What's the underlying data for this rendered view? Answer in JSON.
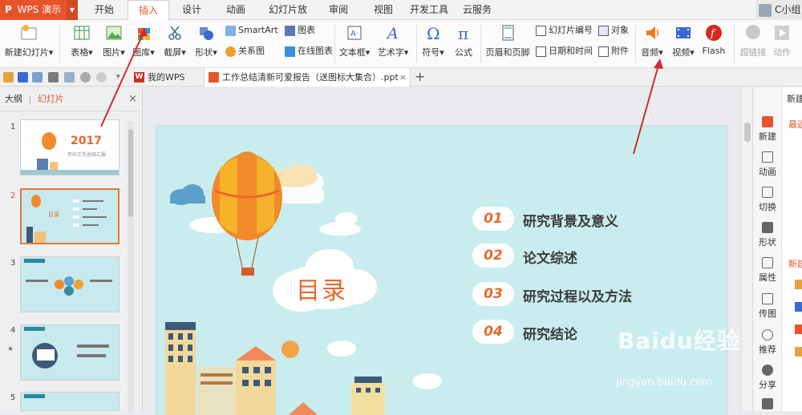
{
  "app": {
    "name": "WPS 演示",
    "user": "C小组"
  },
  "tabs": [
    "开始",
    "插入",
    "设计",
    "动画",
    "幻灯片放映",
    "审阅",
    "视图",
    "开发工具",
    "云服务"
  ],
  "active_tab": "插入",
  "ribbon": {
    "new_slide": "新建幻灯片",
    "table": "表格",
    "picture": "图片",
    "gallery": "图库",
    "screenshot": "截屏",
    "shape": "形状",
    "smartart": "SmartArt",
    "relation": "关系图",
    "chart": "图表",
    "online_chart": "在线图表",
    "textbox": "文本框",
    "wordart": "艺术字",
    "symbol": "符号",
    "formula": "公式",
    "header_footer": "页眉和页脚",
    "slide_number": "幻灯片编号",
    "datetime": "日期和时间",
    "object": "对象",
    "attachment": "附件",
    "audio": "音频",
    "video": "视频",
    "flash": "Flash",
    "hyperlink": "超链接",
    "action": "动作"
  },
  "doc_tabs": {
    "home": "我的WPS",
    "file": "工作总结清新可爱报告（送图标大集合）.ppt"
  },
  "left_panel": {
    "outline": "大纲",
    "slides": "幻灯片",
    "close": "×",
    "thumb1_year": "2017",
    "thumb1_sub": "年中工作总结汇报",
    "thumb2_title": "目录",
    "numbers": [
      "1",
      "2",
      "3",
      "4",
      "5"
    ],
    "selected": 2
  },
  "right_sidebar": {
    "items": [
      "新建",
      "动画",
      "切换",
      "形状",
      "属性",
      "传图",
      "推荐",
      "分享"
    ],
    "panel_top": "新建",
    "panel_recent": "最近",
    "panel_section": "新建"
  },
  "slide": {
    "title": "目录",
    "items": [
      {
        "num": "01",
        "text": "研究背景及意义"
      },
      {
        "num": "02",
        "text": "论文综述"
      },
      {
        "num": "03",
        "text": "研究过程以及方法"
      },
      {
        "num": "04",
        "text": "研究结论"
      }
    ]
  },
  "watermark": {
    "brand": "Baidu经验",
    "url": "jingyan.baidu.com"
  },
  "colors": {
    "accent": "#e8542a",
    "slide_bg": "#c9ecef",
    "number": "#e8682c",
    "arrow": "#d42a2a"
  }
}
